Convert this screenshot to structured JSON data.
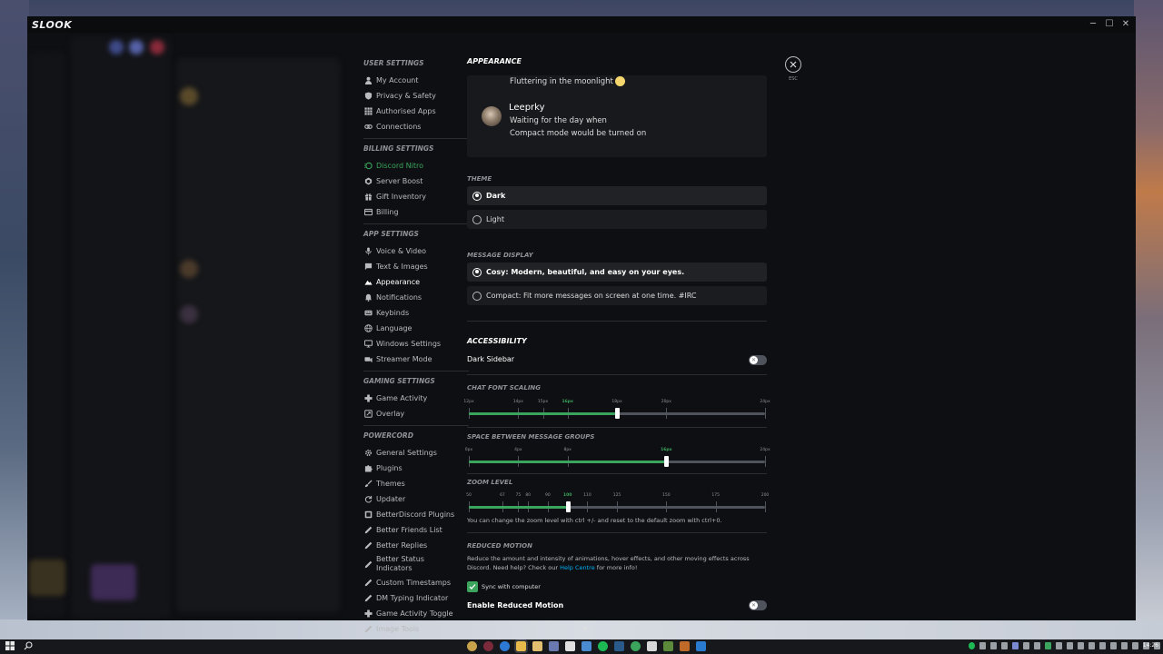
{
  "window": {
    "title": "SLOOK",
    "minimize": "─",
    "maximize": "☐",
    "close": "✕"
  },
  "sidebar": {
    "sections": [
      {
        "header": "User Settings",
        "items": [
          {
            "label": "My Account",
            "icon": "user-icon"
          },
          {
            "label": "Privacy & Safety",
            "icon": "shield-icon"
          },
          {
            "label": "Authorised Apps",
            "icon": "grid-icon"
          },
          {
            "label": "Connections",
            "icon": "link-icon"
          }
        ]
      },
      {
        "header": "Billing Settings",
        "items": [
          {
            "label": "Discord Nitro",
            "icon": "nitro-icon"
          },
          {
            "label": "Server Boost",
            "icon": "boost-icon"
          },
          {
            "label": "Gift Inventory",
            "icon": "gift-icon"
          },
          {
            "label": "Billing",
            "icon": "card-icon"
          }
        ]
      },
      {
        "header": "App Settings",
        "items": [
          {
            "label": "Voice & Video",
            "icon": "mic-icon"
          },
          {
            "label": "Text & Images",
            "icon": "chat-icon"
          },
          {
            "label": "Appearance",
            "icon": "appearance-icon"
          },
          {
            "label": "Notifications",
            "icon": "bell-icon"
          },
          {
            "label": "Keybinds",
            "icon": "keyboard-icon"
          },
          {
            "label": "Language",
            "icon": "globe-icon"
          },
          {
            "label": "Windows Settings",
            "icon": "monitor-icon"
          },
          {
            "label": "Streamer Mode",
            "icon": "camera-icon"
          }
        ]
      },
      {
        "header": "Gaming Settings",
        "items": [
          {
            "label": "Game Activity",
            "icon": "gamepad-icon"
          },
          {
            "label": "Overlay",
            "icon": "overlay-icon"
          }
        ]
      },
      {
        "header": "Powercord",
        "items": [
          {
            "label": "General Settings",
            "icon": "gear-icon"
          },
          {
            "label": "Plugins",
            "icon": "puzzle-icon"
          },
          {
            "label": "Themes",
            "icon": "brush-icon"
          },
          {
            "label": "Updater",
            "icon": "refresh-icon"
          },
          {
            "label": "BetterDiscord Plugins",
            "icon": "bd-icon"
          },
          {
            "label": "Better Friends List",
            "icon": "pen-icon"
          },
          {
            "label": "Better Replies",
            "icon": "pen-icon"
          },
          {
            "label": "Better Status Indicators",
            "icon": "pen-icon"
          },
          {
            "label": "Custom Timestamps",
            "icon": "pen-icon"
          },
          {
            "label": "DM Typing Indicator",
            "icon": "pen-icon"
          },
          {
            "label": "Game Activity Toggle",
            "icon": "gamepad-icon"
          },
          {
            "label": "Image Tools",
            "icon": "pen-icon"
          }
        ]
      }
    ]
  },
  "appearance": {
    "title": "Appearance",
    "preview": {
      "line1": "Fluttering in the moonlight",
      "username": "Leeprky",
      "line2": "Waiting for the day when",
      "line3": "Compact mode would be turned on"
    },
    "theme": {
      "header": "Theme",
      "options": [
        {
          "label": "Dark",
          "selected": true
        },
        {
          "label": "Light",
          "selected": false
        }
      ]
    },
    "message_display": {
      "header": "Message Display",
      "options": [
        {
          "label": "Cosy: Modern, beautiful, and easy on your eyes.",
          "selected": true
        },
        {
          "label": "Compact: Fit more messages on screen at one time. #IRC",
          "selected": false
        }
      ]
    },
    "accessibility": {
      "header": "Accessibility",
      "dark_sidebar": {
        "label": "Dark Sidebar",
        "enabled": false,
        "knob": "✕"
      }
    },
    "font_scaling": {
      "header": "Chat Font Scaling",
      "ticks": [
        "12px",
        "14px",
        "15px",
        "16px",
        "18px",
        "20px",
        "24px"
      ],
      "tick_values": [
        12,
        14,
        15,
        16,
        18,
        20,
        24
      ],
      "min": 12,
      "max": 24,
      "value": 18,
      "current_label": "16px"
    },
    "message_spacing": {
      "header": "Space Between Message Groups",
      "ticks": [
        "0px",
        "4px",
        "8px",
        "16px",
        "24px"
      ],
      "tick_values": [
        0,
        4,
        8,
        16,
        24
      ],
      "min": 0,
      "max": 24,
      "value": 16,
      "current_label": "16px"
    },
    "zoom": {
      "header": "Zoom Level",
      "ticks": [
        "50",
        "67",
        "75",
        "80",
        "90",
        "100",
        "110",
        "125",
        "150",
        "175",
        "200"
      ],
      "tick_values": [
        50,
        67,
        75,
        80,
        90,
        100,
        110,
        125,
        150,
        175,
        200
      ],
      "min": 50,
      "max": 200,
      "value": 100,
      "current_label": "100",
      "note": "You can change the zoom level with ctrl +/- and reset to the default zoom with ctrl+0."
    },
    "reduced_motion": {
      "header": "Reduced Motion",
      "desc_before": "Reduce the amount and intensity of animations, hover effects, and other moving effects across Discord. Need help? Check our ",
      "link": "Help Centre",
      "desc_after": " for more info!",
      "sync_label": "Sync with computer",
      "sync_checked": true,
      "enable_label": "Enable Reduced Motion",
      "enable_on": false,
      "knob": "✕"
    }
  },
  "close": {
    "icon": "✕",
    "label": "ESC"
  },
  "taskbar": {
    "time": "14:26"
  },
  "colors": {
    "accent": "#3ba55d",
    "link": "#00aff4",
    "background": "#0e0f12"
  }
}
